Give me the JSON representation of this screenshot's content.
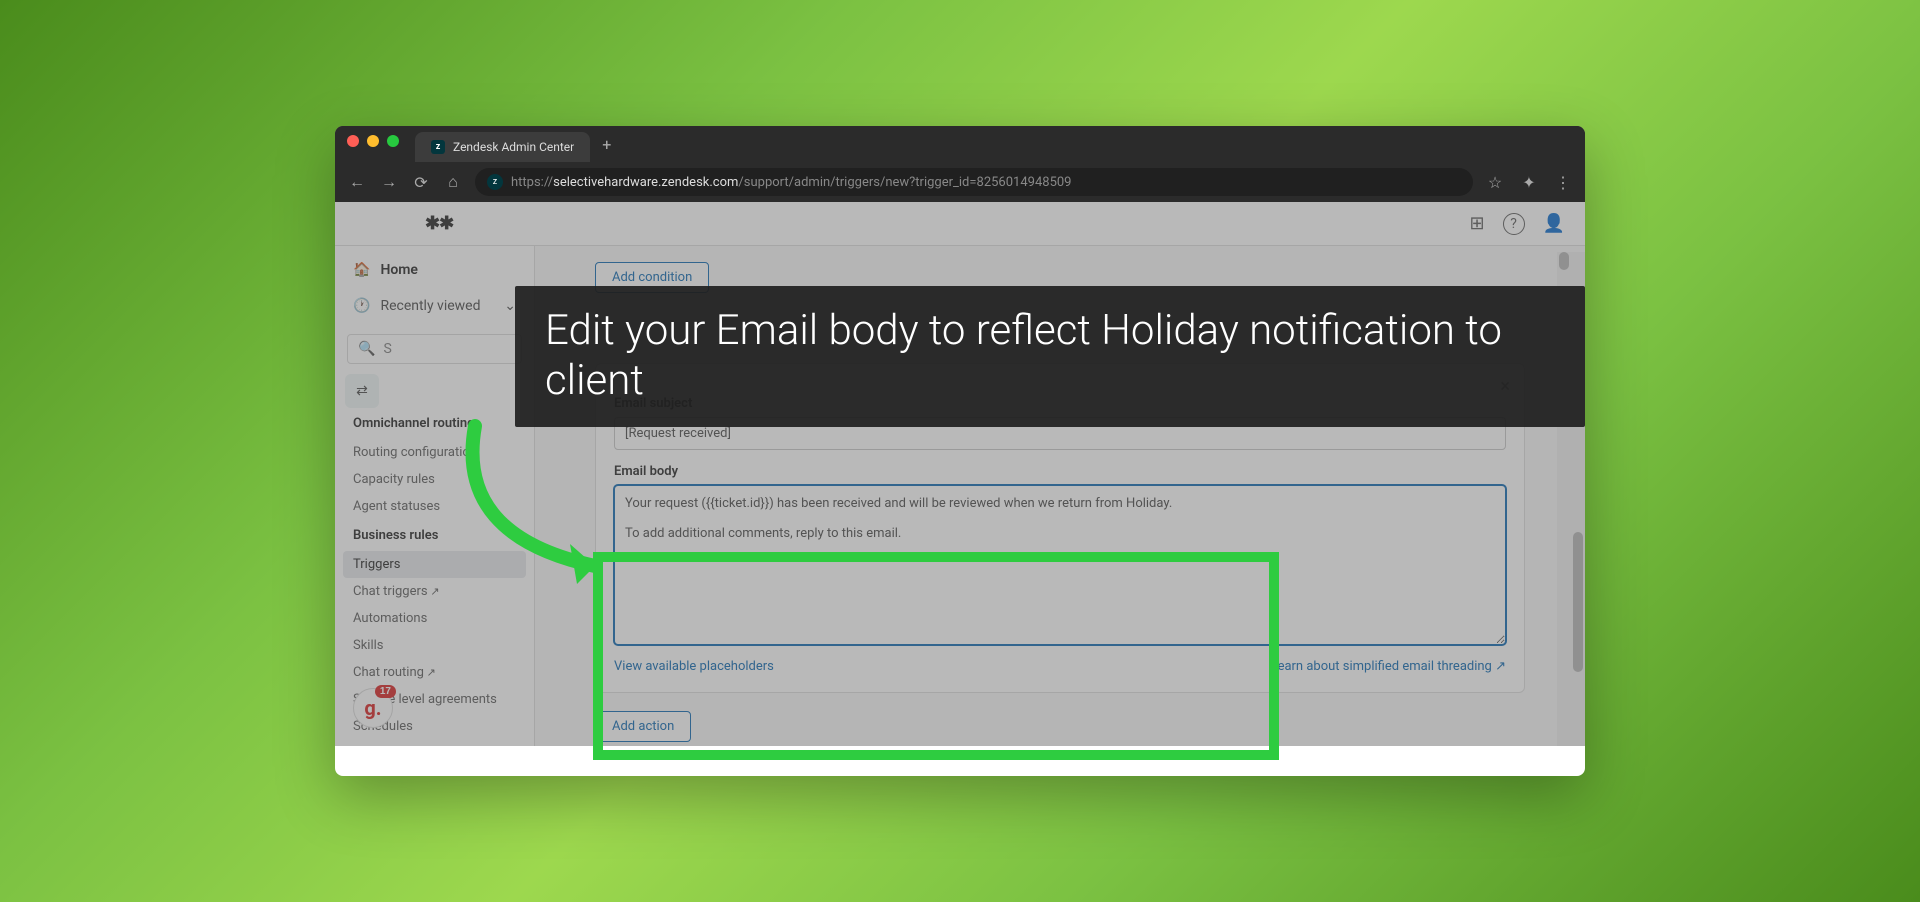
{
  "browser": {
    "tab_title": "Zendesk Admin Center",
    "url_full": "https://selectivehardware.zendesk.com/support/admin/triggers/new?trigger_id=8256014948509",
    "url_domain": "selectivehardware.zendesk.com",
    "url_path": "/support/admin/triggers/new?trigger_id=8256014948509",
    "new_tab": "+",
    "star": "☆",
    "extensions": "✦",
    "menu": "⋮"
  },
  "header": {
    "logo": "✱✱",
    "apps_icon": "⊞",
    "help_icon": "?",
    "user_icon": "👤"
  },
  "sidebar": {
    "home": "Home",
    "recent": "Recently viewed",
    "search_placeholder": "S",
    "section1": "Omnichannel routing",
    "items1": [
      "Routing configuration",
      "Capacity rules",
      "Agent statuses"
    ],
    "section2": "Business rules",
    "items2": [
      "Triggers",
      "Chat triggers",
      "Automations",
      "Skills",
      "Chat routing",
      "Service level agreements",
      "Schedules"
    ],
    "badge_count": "17",
    "badge_letter": "g."
  },
  "form": {
    "add_condition": "Add condition",
    "subject_label": "Email subject",
    "subject_value": "[Request received]",
    "body_label": "Email body",
    "body_value": "Your request ({{ticket.id}}) has been received and will be reviewed when we return from Holiday.\n\nTo add additional comments, reply to this email.",
    "placeholders_link": "View available placeholders",
    "threading_link": "Learn about simplified email threading",
    "add_action": "Add action"
  },
  "callout": {
    "text": "Edit your Email body to reflect Holiday notification to client"
  }
}
